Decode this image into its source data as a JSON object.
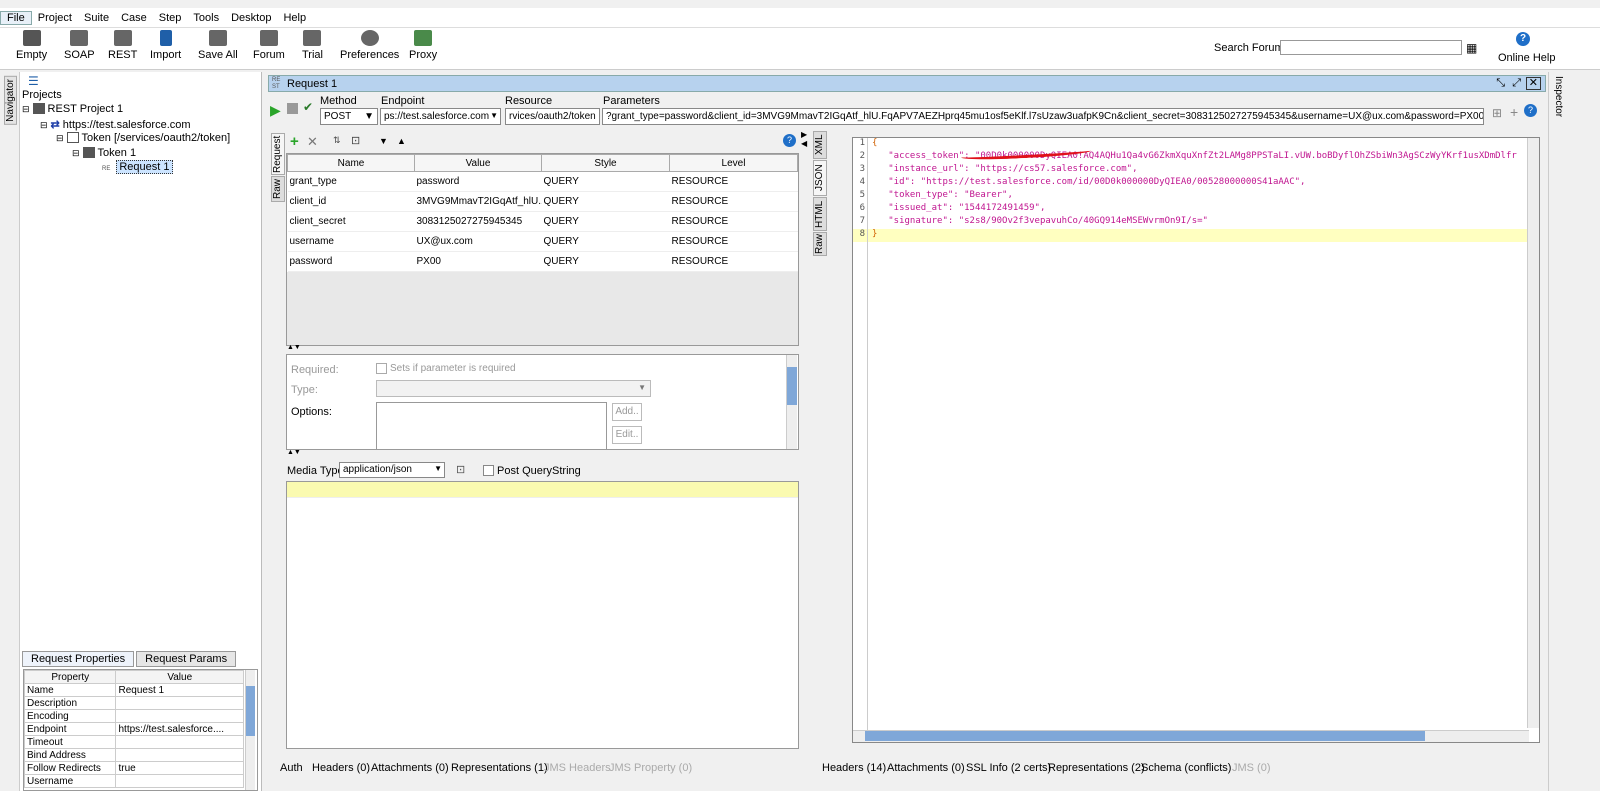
{
  "menu": [
    "File",
    "Project",
    "Suite",
    "Case",
    "Step",
    "Tools",
    "Desktop",
    "Help"
  ],
  "toolbar": {
    "buttons": [
      {
        "label": "Empty",
        "icon": "empty-project-icon"
      },
      {
        "label": "SOAP",
        "icon": "soap-icon"
      },
      {
        "label": "REST",
        "icon": "rest-icon"
      },
      {
        "label": "Import",
        "icon": "import-icon"
      },
      {
        "label": "Save All",
        "icon": "save-all-icon"
      },
      {
        "label": "Forum",
        "icon": "forum-icon"
      },
      {
        "label": "Trial",
        "icon": "trial-icon"
      },
      {
        "label": "Preferences",
        "icon": "gear-icon"
      },
      {
        "label": "Proxy",
        "icon": "proxy-icon"
      }
    ],
    "search_label": "Search Forum",
    "search_value": "",
    "help_label": "Online Help"
  },
  "navigator": {
    "strip_label": "Navigator",
    "projects_label": "Projects",
    "tree": [
      {
        "label": "REST Project 1"
      },
      {
        "label": "https://test.salesforce.com"
      },
      {
        "label": "Token [/services/oauth2/token]"
      },
      {
        "label": "Token 1"
      },
      {
        "label": "Request 1"
      }
    ]
  },
  "properties": {
    "tabs": [
      "Request Properties",
      "Request Params"
    ],
    "headers": [
      "Property",
      "Value"
    ],
    "rows": [
      [
        "Name",
        "Request 1"
      ],
      [
        "Description",
        ""
      ],
      [
        "Encoding",
        ""
      ],
      [
        "Endpoint",
        "https://test.salesforce...."
      ],
      [
        "Timeout",
        ""
      ],
      [
        "Bind Address",
        ""
      ],
      [
        "Follow Redirects",
        "true"
      ],
      [
        "Username",
        ""
      ]
    ]
  },
  "request": {
    "title": "Request 1",
    "method_label": "Method",
    "method_value": "POST",
    "endpoint_label": "Endpoint",
    "endpoint_value": "ps://test.salesforce.com",
    "resource_label": "Resource",
    "resource_value": "rvices/oauth2/token",
    "parameters_label": "Parameters",
    "parameters_value": "?grant_type=password&client_id=3MVG9MmavT2IGqAtf_hlU.FqAPV7AEZHprq45mu1osf5eKlf.l7sUzaw3uafpK9Cn&client_secret=3083125027275945345&username=UX@ux.com&password=PX00",
    "side_tabs": [
      "Request",
      "Raw"
    ],
    "params_headers": [
      "Name",
      "Value",
      "Style",
      "Level"
    ],
    "params": [
      [
        "grant_type",
        "password",
        "QUERY",
        "RESOURCE"
      ],
      [
        "client_id",
        "3MVG9MmavT2IGqAtf_hlU....",
        "QUERY",
        "RESOURCE"
      ],
      [
        "client_secret",
        "3083125027275945345",
        "QUERY",
        "RESOURCE"
      ],
      [
        "username",
        "UX@ux.com",
        "QUERY",
        "RESOURCE"
      ],
      [
        "password",
        "PX00",
        "QUERY",
        "RESOURCE"
      ]
    ],
    "detail": {
      "required_label": "Required:",
      "required_check": "Sets if parameter is required",
      "type_label": "Type:",
      "options_label": "Options:",
      "add_btn": "Add..",
      "edit_btn": "Edit.."
    },
    "media_type_label": "Media Type",
    "media_type_value": "application/json",
    "post_query_label": "Post QueryString",
    "bottom_tabs": [
      {
        "label": "Auth",
        "disabled": false
      },
      {
        "label": "Headers (0)",
        "disabled": false
      },
      {
        "label": "Attachments (0)",
        "disabled": false
      },
      {
        "label": "Representations (1)",
        "disabled": false
      },
      {
        "label": "JMS Headers",
        "disabled": true
      },
      {
        "label": "JMS Property (0)",
        "disabled": true
      }
    ]
  },
  "response": {
    "side_tabs": [
      "XML",
      "JSON",
      "HTML",
      "Raw"
    ],
    "lines": [
      {
        "n": "1",
        "text": "{"
      },
      {
        "n": "2",
        "text": "   \"access_token\": \"00D0k000000DyQIEA0!AQ4AQHu1Qa4vG6ZkmXquXnfZt2LAMg8PPSTaLI.vUW.boBDyflOhZSbiWn3AgSCzWyYKrf1usXDmDlfr"
      },
      {
        "n": "3",
        "text": "   \"instance_url\": \"https://cs57.salesforce.com\","
      },
      {
        "n": "4",
        "text": "   \"id\": \"https://test.salesforce.com/id/00D0k000000DyQIEA0/00528000000S41aAAC\","
      },
      {
        "n": "5",
        "text": "   \"token_type\": \"Bearer\","
      },
      {
        "n": "6",
        "text": "   \"issued_at\": \"1544172491459\","
      },
      {
        "n": "7",
        "text": "   \"signature\": \"s2s8/90Ov2f3vepavuhCo/40GQ914eMSEWvrmOn9I/s=\""
      },
      {
        "n": "8",
        "text": "}"
      }
    ],
    "bottom_tabs": [
      {
        "label": "Headers (14)",
        "disabled": false
      },
      {
        "label": "Attachments (0)",
        "disabled": false
      },
      {
        "label": "SSL Info (2 certs)",
        "disabled": false
      },
      {
        "label": "Representations (2)",
        "disabled": false
      },
      {
        "label": "Schema (conflicts)",
        "disabled": false
      },
      {
        "label": "JMS (0)",
        "disabled": true
      }
    ]
  },
  "inspector_label": "Inspector",
  "colors": {
    "title_bar": "#b7d2ee",
    "json_text": "#c01690",
    "highlight_line": "#ffffc0",
    "selected": "#cce4ff"
  }
}
